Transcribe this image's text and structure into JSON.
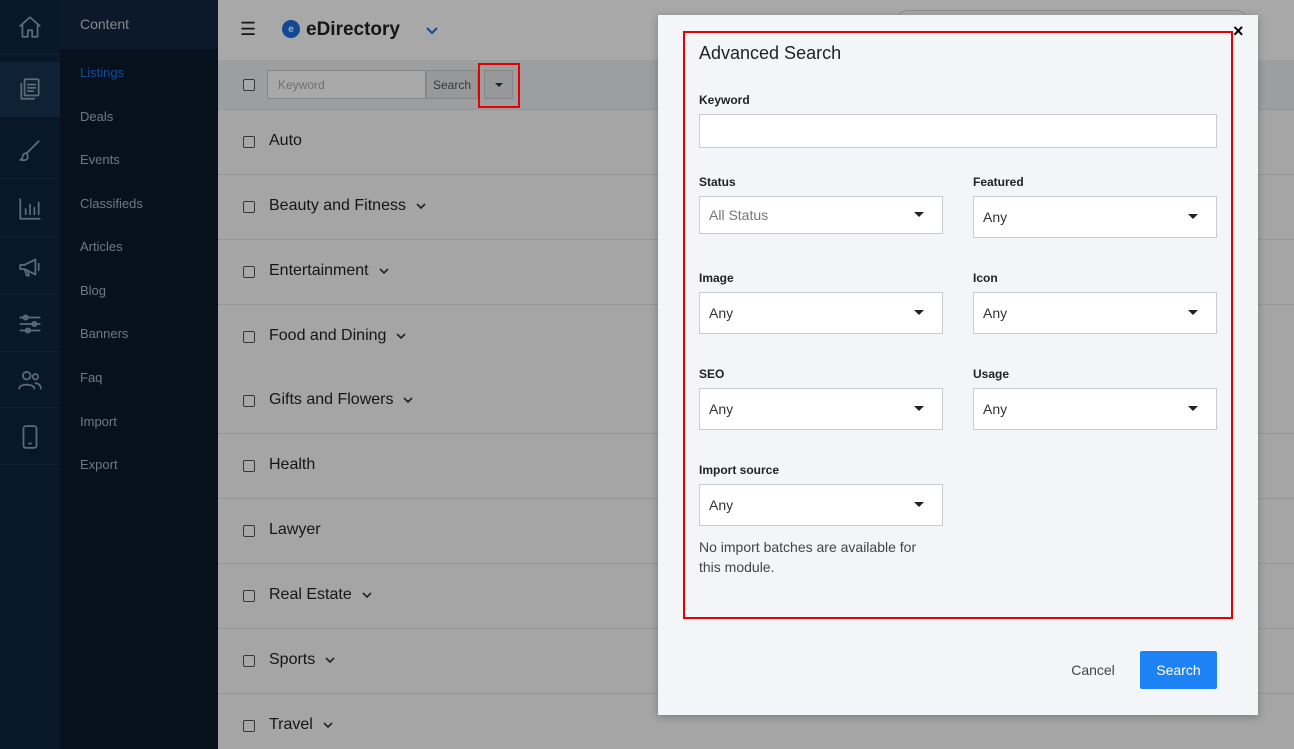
{
  "rail": {
    "active_index": 1,
    "icons": [
      "home-icon",
      "documents-icon",
      "brush-icon",
      "bar-chart-icon",
      "megaphone-icon",
      "sliders-icon",
      "users-icon",
      "mobile-icon"
    ]
  },
  "subnav": {
    "header": "Content",
    "items": [
      "Listings",
      "Deals",
      "Events",
      "Classifieds",
      "Articles",
      "Blog",
      "Banners",
      "Faq",
      "Import",
      "Export"
    ],
    "active": "Listings"
  },
  "topbar": {
    "brand": "eDirectory",
    "logo_letter": "e"
  },
  "toolbar": {
    "keyword_placeholder": "Keyword",
    "search_label": "Search"
  },
  "categories": [
    {
      "label": "Auto",
      "has_children": false
    },
    {
      "label": "Beauty and Fitness",
      "has_children": true
    },
    {
      "label": "Entertainment",
      "has_children": true
    },
    {
      "label": "Food and Dining",
      "has_children": true
    },
    {
      "label": "Gifts and Flowers",
      "has_children": true
    },
    {
      "label": "Health",
      "has_children": false
    },
    {
      "label": "Lawyer",
      "has_children": false
    },
    {
      "label": "Real Estate",
      "has_children": true
    },
    {
      "label": "Sports",
      "has_children": true
    },
    {
      "label": "Travel",
      "has_children": true
    }
  ],
  "modal": {
    "close": "×",
    "title": "Advanced Search",
    "keyword_label": "Keyword",
    "status_label": "Status",
    "status_value": "All Status",
    "featured_label": "Featured",
    "featured_value": "Any",
    "image_label": "Image",
    "image_value": "Any",
    "icon_label": "Icon",
    "icon_value": "Any",
    "seo_label": "SEO",
    "seo_value": "Any",
    "usage_label": "Usage",
    "usage_value": "Any",
    "import_label": "Import source",
    "import_value": "Any",
    "import_help": "No import batches are available for this module.",
    "cancel_label": "Cancel",
    "search_label": "Search"
  },
  "colors": {
    "accent": "#1d82f5",
    "highlight": "#e60000",
    "rail_bg": "#0e2440",
    "subnav_bg": "#0b1a2e"
  }
}
